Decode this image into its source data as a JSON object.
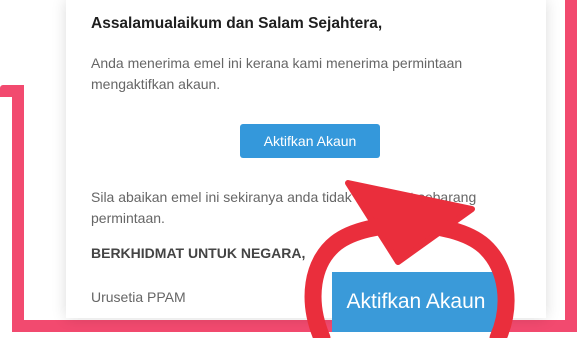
{
  "email": {
    "greeting": "Assalamualaikum dan Salam Sejahtera,",
    "intro": "Anda menerima emel ini kerana kami menerima permintaan mengaktifkan akaun.",
    "activate_label": "Aktifkan Akaun",
    "ignore_note": "Sila abaikan emel ini sekiranya anda tidak membuat sebarang permintaan.",
    "motto": "BERKHIDMAT UNTUK NEGARA,",
    "sender": "Urusetia PPAM"
  },
  "callout": {
    "zoom_label": "Aktifkan Akaun"
  },
  "colors": {
    "frame": "#f24a6f",
    "button": "#3498db",
    "highlight": "#ea2e3c"
  }
}
